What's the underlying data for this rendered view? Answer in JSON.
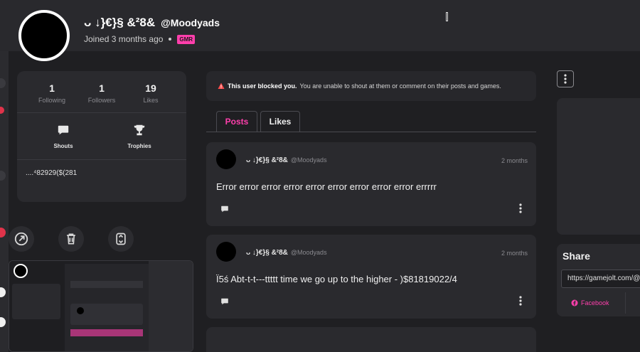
{
  "profile": {
    "display_name": "ᴗ ↓}€}§ &²8&",
    "username": "@Moodyads",
    "joined": "Joined 3 months ago",
    "badge": "GMR"
  },
  "stats": [
    {
      "value": "1",
      "label": "Following"
    },
    {
      "value": "1",
      "label": "Followers"
    },
    {
      "value": "19",
      "label": "Likes"
    }
  ],
  "shortcuts": {
    "shouts": "Shouts",
    "trophies": "Trophies"
  },
  "bio": "....⁴82929($(281",
  "notice": {
    "strong": "This user blocked you.",
    "text": "You are unable to shout at them or comment on their posts and games."
  },
  "tabs": {
    "posts": "Posts",
    "likes": "Likes"
  },
  "posts": [
    {
      "name": "ᴗ ↓}€}§ &²8&",
      "user": "@Moodyads",
      "time": "2 months",
      "body": "Error error error error error error error error error errrrr"
    },
    {
      "name": "ᴗ ↓}€}§ &²8&",
      "user": "@Moodyads",
      "time": "2 months",
      "body": "Ï5ś Abt-t-t---ttttt time we go up to the higher - )$81819022/4"
    }
  ],
  "share": {
    "title": "Share",
    "url": "https://gamejolt.com/@",
    "facebook": "Facebook"
  },
  "colors": {
    "accent": "#ff3fac",
    "background": "#1f1f22",
    "card": "#2a2a2e",
    "warning": "#ff4d4d"
  }
}
